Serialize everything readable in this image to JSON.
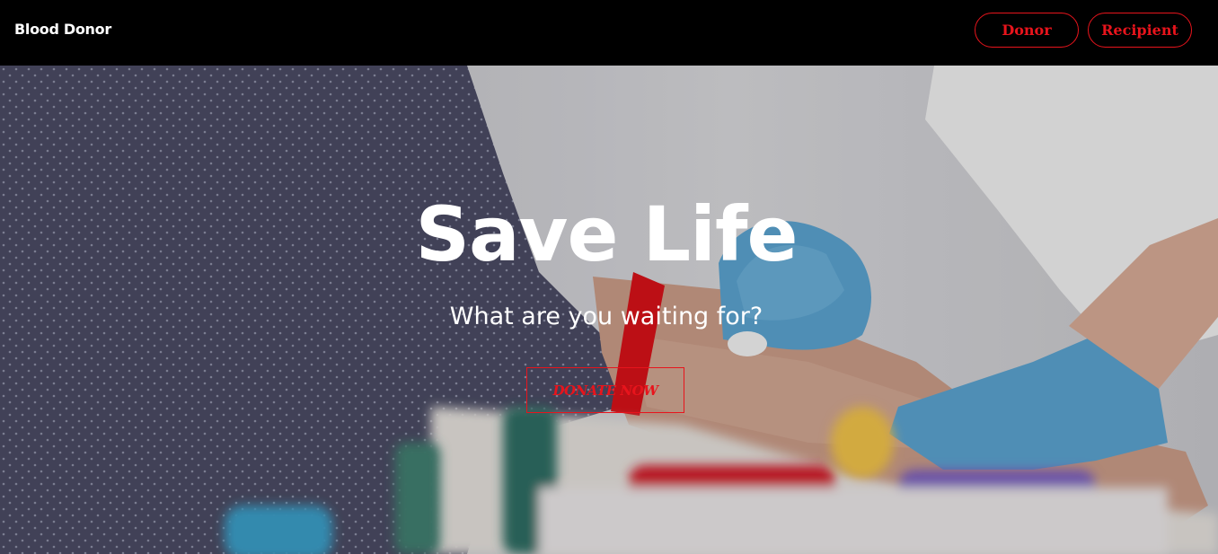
{
  "navbar": {
    "brand": "Blood Donor",
    "donor_label": "Donor",
    "recipient_label": "Recipient"
  },
  "hero": {
    "title": "Save Life",
    "subtitle": "What are you waiting for?",
    "cta_label": "DONATE NOW"
  },
  "colors": {
    "accent": "#e8141c",
    "navbar_bg": "#000000",
    "text": "#ffffff"
  }
}
